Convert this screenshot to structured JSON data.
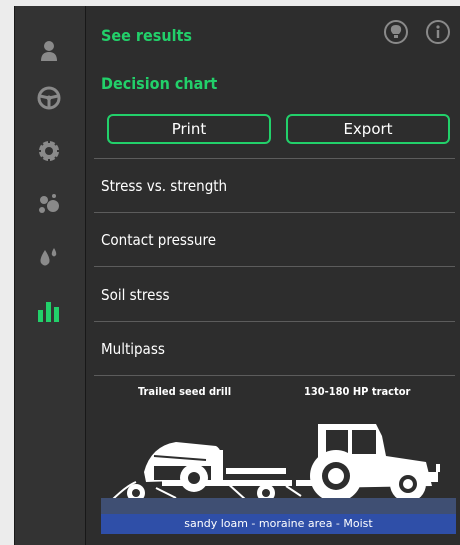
{
  "colors": {
    "accent": "#22d06a",
    "sidebar_bg": "#333333",
    "panel_bg": "#2d2d2d",
    "soil_band": "#2f4fa8"
  },
  "sidebar": {
    "items": [
      {
        "icon": "person-icon",
        "active": false
      },
      {
        "icon": "steering-wheel-icon",
        "active": false
      },
      {
        "icon": "tire-icon",
        "active": false
      },
      {
        "icon": "soil-particles-icon",
        "active": false
      },
      {
        "icon": "water-drops-icon",
        "active": false
      },
      {
        "icon": "bar-chart-icon",
        "active": true
      }
    ]
  },
  "header": {
    "see_results": "See results",
    "decision_chart": "Decision chart",
    "icons": [
      "lightbulb-icon",
      "info-icon"
    ]
  },
  "buttons": {
    "print": "Print",
    "export": "Export"
  },
  "menu": {
    "items": [
      {
        "label": "Stress vs. strength"
      },
      {
        "label": "Contact pressure"
      },
      {
        "label": "Soil stress"
      },
      {
        "label": "Multipass"
      }
    ]
  },
  "illustration": {
    "implement_label": "Trailed seed drill",
    "tractor_label": "130-180 HP tractor",
    "soil_label": "sandy loam - moraine area - Moist"
  }
}
